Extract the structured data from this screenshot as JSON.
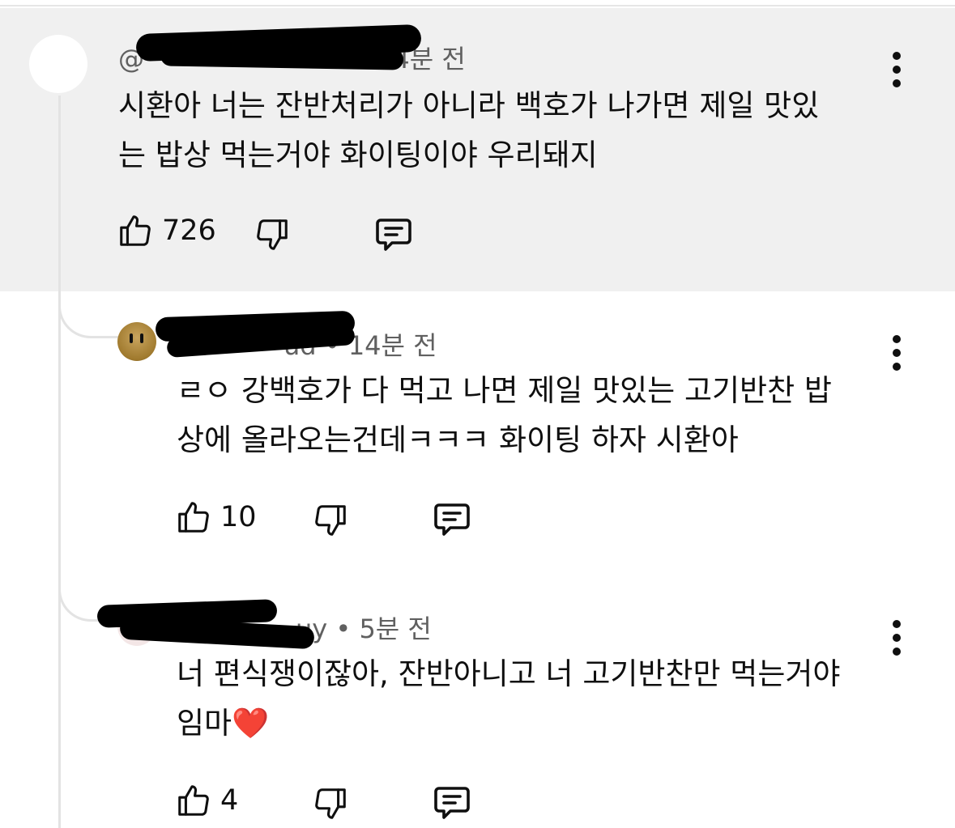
{
  "comments": [
    {
      "time": "34분 전",
      "author_fragment": "@",
      "text_lines": [
        "시환아 너는 잔반처리가 아니라 백호가 나가면 제일 맛있",
        "는 밥상 먹는거야 화이팅이야 우리돼지"
      ],
      "likes": "726",
      "highlighted": true
    },
    {
      "time": "14분 전",
      "author_fragment": "ud",
      "text_lines": [
        "ㄹㅇ 강백호가 다 먹고 나면 제일 맛있는 고기반찬 밥",
        "상에 올라오는건데ㅋㅋㅋ 화이팅 하자 시환아"
      ],
      "likes": "10"
    },
    {
      "time": "5분 전",
      "author_fragment": "uy",
      "text_lines": [
        "너 편식쟁이잖아, 잔반아니고 너 고기반찬만 먹는거야",
        "임마"
      ],
      "emoji": "❤️",
      "likes": "4"
    }
  ],
  "separator": "•",
  "icons": {
    "like": "thumbs-up-icon",
    "dislike": "thumbs-down-icon",
    "reply": "reply-comment-icon",
    "more": "kebab-menu-icon"
  },
  "colors": {
    "highlight_bg": "#f0f0f0",
    "meta_text": "#606060",
    "thread_line": "#e3e3e3"
  }
}
